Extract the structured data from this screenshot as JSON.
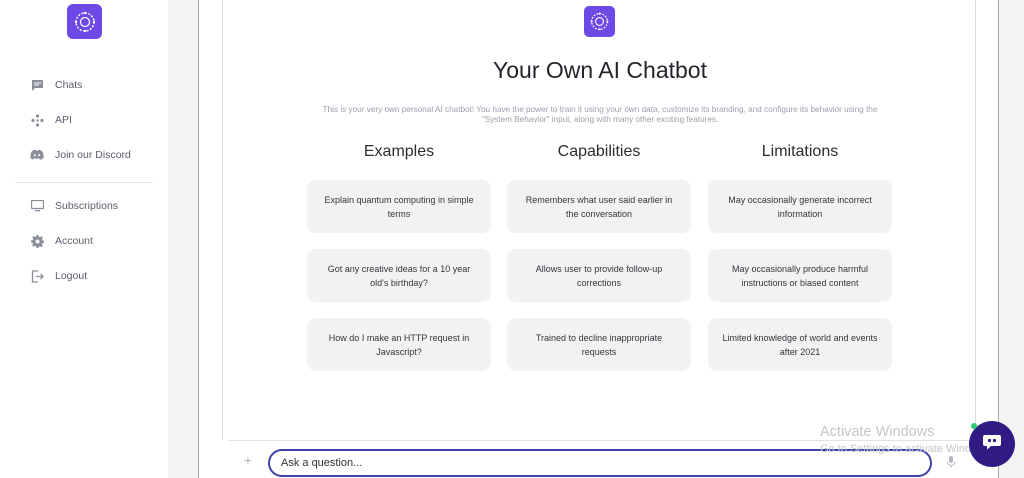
{
  "sidebar": {
    "logo_icon": "brain-circuit-icon",
    "items": [
      {
        "label": "Chats",
        "icon": "chat-icon"
      },
      {
        "label": "API",
        "icon": "api-nodes-icon"
      },
      {
        "label": "Join our Discord",
        "icon": "discord-icon"
      },
      {
        "label": "Subscriptions",
        "icon": "monitor-icon"
      },
      {
        "label": "Account",
        "icon": "gear-icon"
      },
      {
        "label": "Logout",
        "icon": "logout-icon"
      }
    ]
  },
  "main": {
    "logo_icon": "brain-circuit-icon",
    "title": "Your Own AI Chatbot",
    "subtitle": "This is your very own personal AI chatbot! You have the power to train it using your own data, customize its branding, and configure its behavior using the \"System Behavior\" input, along with many other exciting features.",
    "columns": [
      {
        "heading": "Examples",
        "cards": [
          "Explain quantum computing in simple terms",
          "Got any creative ideas for a 10 year old's birthday?",
          "How do I make an HTTP request in Javascript?"
        ]
      },
      {
        "heading": "Capabilities",
        "cards": [
          "Remembers what user said earlier in the conversation",
          "Allows user to provide follow-up corrections",
          "Trained to decline inappropriate requests"
        ]
      },
      {
        "heading": "Limitations",
        "cards": [
          "May occasionally generate incorrect information",
          "May occasionally produce harmful instructions or biased content",
          "Limited knowledge of world and events after 2021"
        ]
      }
    ]
  },
  "composer": {
    "placeholder": "Ask a question...",
    "plus_icon": "plus-icon",
    "mic_icon": "microphone-icon"
  },
  "watermark": {
    "line1": "Activate Windows",
    "line2": "Go to Settings to activate Windows."
  },
  "fab": {
    "icon": "chat-bubble-icon"
  },
  "colors": {
    "brand": "#6d49e6",
    "fab": "#2f1b82",
    "input_border": "#3d44a7",
    "card_bg": "#f2f2f3"
  }
}
